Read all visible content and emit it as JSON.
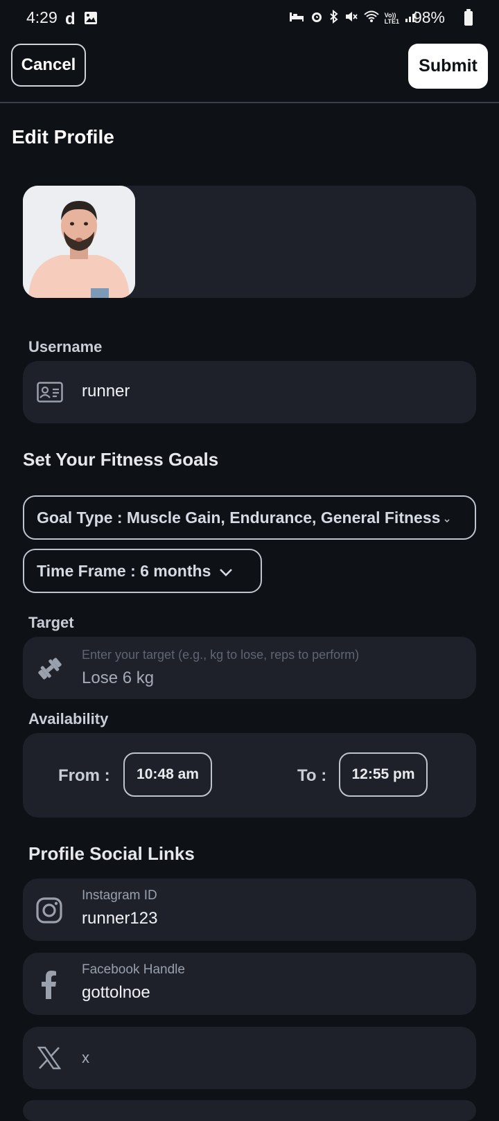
{
  "status_bar": {
    "time": "4:29",
    "left_icons": [
      "d-app-icon",
      "gallery-icon"
    ],
    "right_icons": [
      "bed-icon",
      "alarm-icon",
      "bluetooth-icon",
      "mute-icon",
      "wifi-icon",
      "volte-icon",
      "signal-icon"
    ],
    "volte_label": "Vo))\nLTE1",
    "battery": "98%"
  },
  "header": {
    "cancel_label": "Cancel",
    "submit_label": "Submit"
  },
  "page_title": "Edit Profile",
  "username": {
    "label": "Username",
    "value": "runner",
    "icon": "id-card-icon"
  },
  "fitness": {
    "title": "Set Your Fitness Goals",
    "goal_type": "Goal Type : Muscle Gain, Endurance, General Fitness",
    "time_frame": "Time Frame : 6 months",
    "target_label": "Target",
    "target_placeholder": "Enter your target (e.g., kg to lose, reps to perform)",
    "target_value": "Lose 6 kg",
    "target_icon": "dumbbell-icon",
    "availability_label": "Availability",
    "from_label": "From :",
    "from_value": "10:48 am",
    "to_label": "To :",
    "to_value": "12:55 pm"
  },
  "social": {
    "title": "Profile Social Links",
    "instagram_label": "Instagram ID",
    "instagram_value": "runner123",
    "facebook_label": "Facebook Handle",
    "facebook_value": "gottolnoe",
    "x_value": "x"
  },
  "colors": {
    "background": "#0e1116",
    "card": "#1e212a",
    "border": "#bfc5cf",
    "text": "#e7e9ee"
  }
}
